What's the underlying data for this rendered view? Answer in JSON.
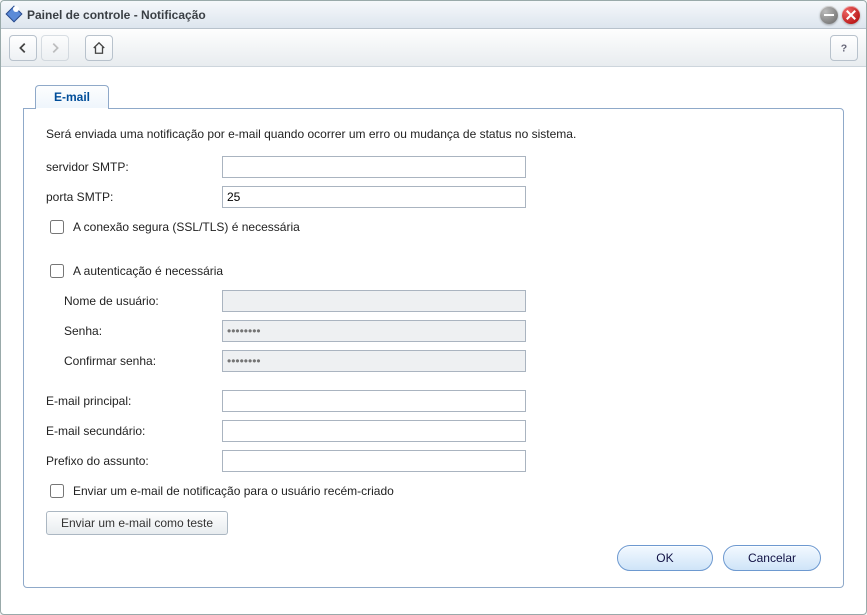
{
  "window": {
    "title": "Painel de controle - Notificação"
  },
  "tabs": {
    "email": "E-mail"
  },
  "form": {
    "description": "Será enviada uma notificação por e-mail quando ocorrer um erro ou mudança de status no sistema.",
    "smtp_server_label": "servidor SMTP:",
    "smtp_server_value": "",
    "smtp_port_label": "porta SMTP:",
    "smtp_port_value": "25",
    "ssl_required_label": "A conexão segura (SSL/TLS) é necessária",
    "ssl_required_checked": false,
    "auth_required_label": "A autenticação é necessária",
    "auth_required_checked": false,
    "username_label": "Nome de usuário:",
    "username_value": "",
    "password_label": "Senha:",
    "password_value": "",
    "password_placeholder": "••••••••",
    "confirm_password_label": "Confirmar senha:",
    "confirm_password_value": "",
    "confirm_password_placeholder": "••••••••",
    "primary_email_label": "E-mail principal:",
    "primary_email_value": "",
    "secondary_email_label": "E-mail secundário:",
    "secondary_email_value": "",
    "subject_prefix_label": "Prefixo do assunto:",
    "subject_prefix_value": "",
    "send_new_user_label": "Enviar um e-mail de notificação para o usuário recém-criado",
    "send_new_user_checked": false,
    "test_button_label": "Enviar um e-mail como teste"
  },
  "buttons": {
    "ok": "OK",
    "cancel": "Cancelar"
  }
}
